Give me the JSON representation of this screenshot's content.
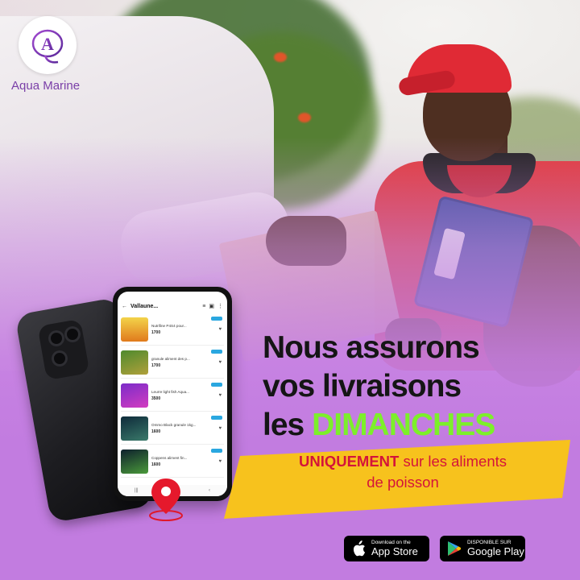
{
  "brand": {
    "name": "Aqua Marine",
    "logo_letter": "A",
    "accent_color": "#7a3fa8"
  },
  "headline": {
    "line1": "Nous assurons",
    "line2": "vos livraisons",
    "line3_prefix": "les",
    "line3_accent": "DIMANCHES",
    "accent_color": "#7cf02a"
  },
  "banner": {
    "emphasis": "UNIQUEMENT",
    "text_rest": "sur les aliments",
    "line2": "de poisson",
    "background_color": "#f7c21d",
    "text_color": "#d4143a"
  },
  "phone": {
    "app_title": "Vallaune...",
    "items": [
      {
        "name": "Nutrifine P4S4 pour...",
        "price": "1700"
      },
      {
        "name": "granule aliment des p...",
        "price": "1700"
      },
      {
        "name": "Leurre light fish Aqua...",
        "price": "3500"
      },
      {
        "name": "Ommo Black granule 1kg...",
        "price": "1600"
      },
      {
        "name": "Coppens aliment fin...",
        "price": "1600"
      }
    ]
  },
  "stores": {
    "appstore": {
      "small": "Download on the",
      "big": "App Store",
      "icon": "apple-icon"
    },
    "googleplay": {
      "small": "DISPONIBLE SUR",
      "big": "Google Play",
      "icon": "google-play-icon"
    }
  }
}
